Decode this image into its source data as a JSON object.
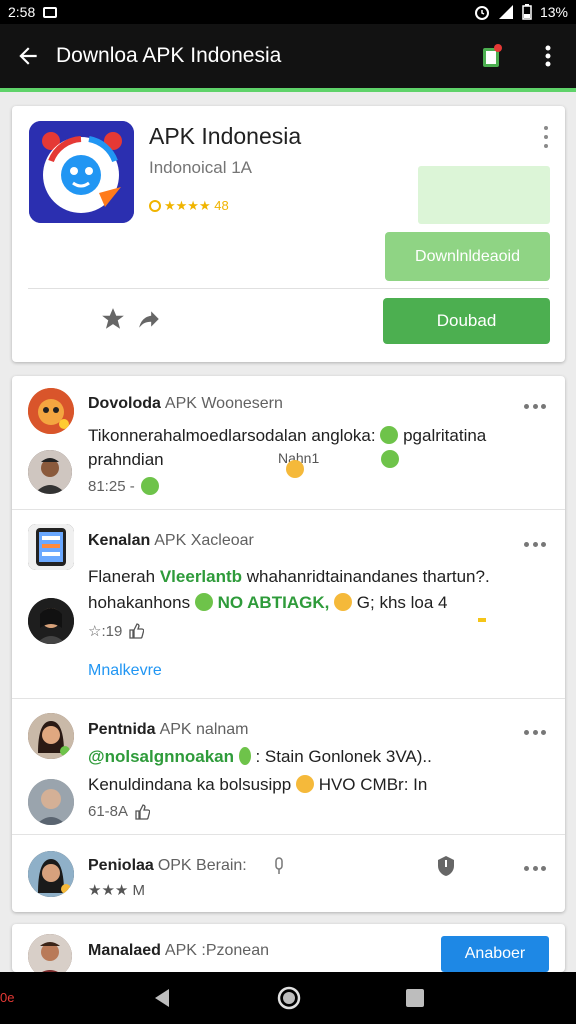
{
  "status_bar": {
    "time": "2:58",
    "battery": "13%",
    "icons": [
      "image-icon",
      "alarm-icon",
      "signal-icon",
      "battery-icon"
    ]
  },
  "app_bar": {
    "title": "Downloa APK Indonesia",
    "icons": [
      "back-arrow-icon",
      "notification-icon",
      "overflow-menu-icon"
    ]
  },
  "app_card": {
    "name": "APK Indonesia",
    "subtitle": "Indonoical 1A",
    "rating_text": "★★★★ 48",
    "button_light": "Downlnldeaoid",
    "button_main": "Doubad",
    "accent": "#4caf50",
    "accent_light": "#8fd484"
  },
  "comments": [
    {
      "name_bold": "Dovoloda",
      "name_rest": "APK Woonesern",
      "line1": "Tikonnerahalmoedlarsodalan angloka:",
      "line1_tail": "pgalritatina",
      "line2": "prahndian",
      "line2_mid": "Nahn1",
      "meta": "81:25 -"
    },
    {
      "name_bold": "Kenalan",
      "name_rest": "APK Xacleoar",
      "line1_pre": "Flanerah",
      "line1_green": "Vleerlantb",
      "line1_post": "whahanridtainandanes thartun?.",
      "line2_pre": "hohakanhons",
      "line2_green": "NO ABTIAGK,",
      "line2_post": "G; khs loa 4",
      "meta": "☆:19",
      "link": "Mnalkevre"
    },
    {
      "name_bold": "Pentnida",
      "name_rest": "APK nalnam",
      "line1_green": "@nolsalgnnoakan",
      "line1_post": ": Stain Gonlonek 3VA)..",
      "line2": "Kenuldindana ka bolsusipp",
      "line2_post": "HVO CMBr: In",
      "meta": "61-8A"
    },
    {
      "name_bold": "Peniolaa",
      "name_rest": "OPK Berain:",
      "meta": "★★★ M"
    }
  ],
  "bottom_item": {
    "name_bold": "Manalaed",
    "name_rest": "APK :Pzonean",
    "button": "Anaboer"
  },
  "nav_bar": {
    "left_text": "0e",
    "icons": [
      "nav-back-icon",
      "nav-home-icon",
      "nav-recents-icon"
    ]
  }
}
